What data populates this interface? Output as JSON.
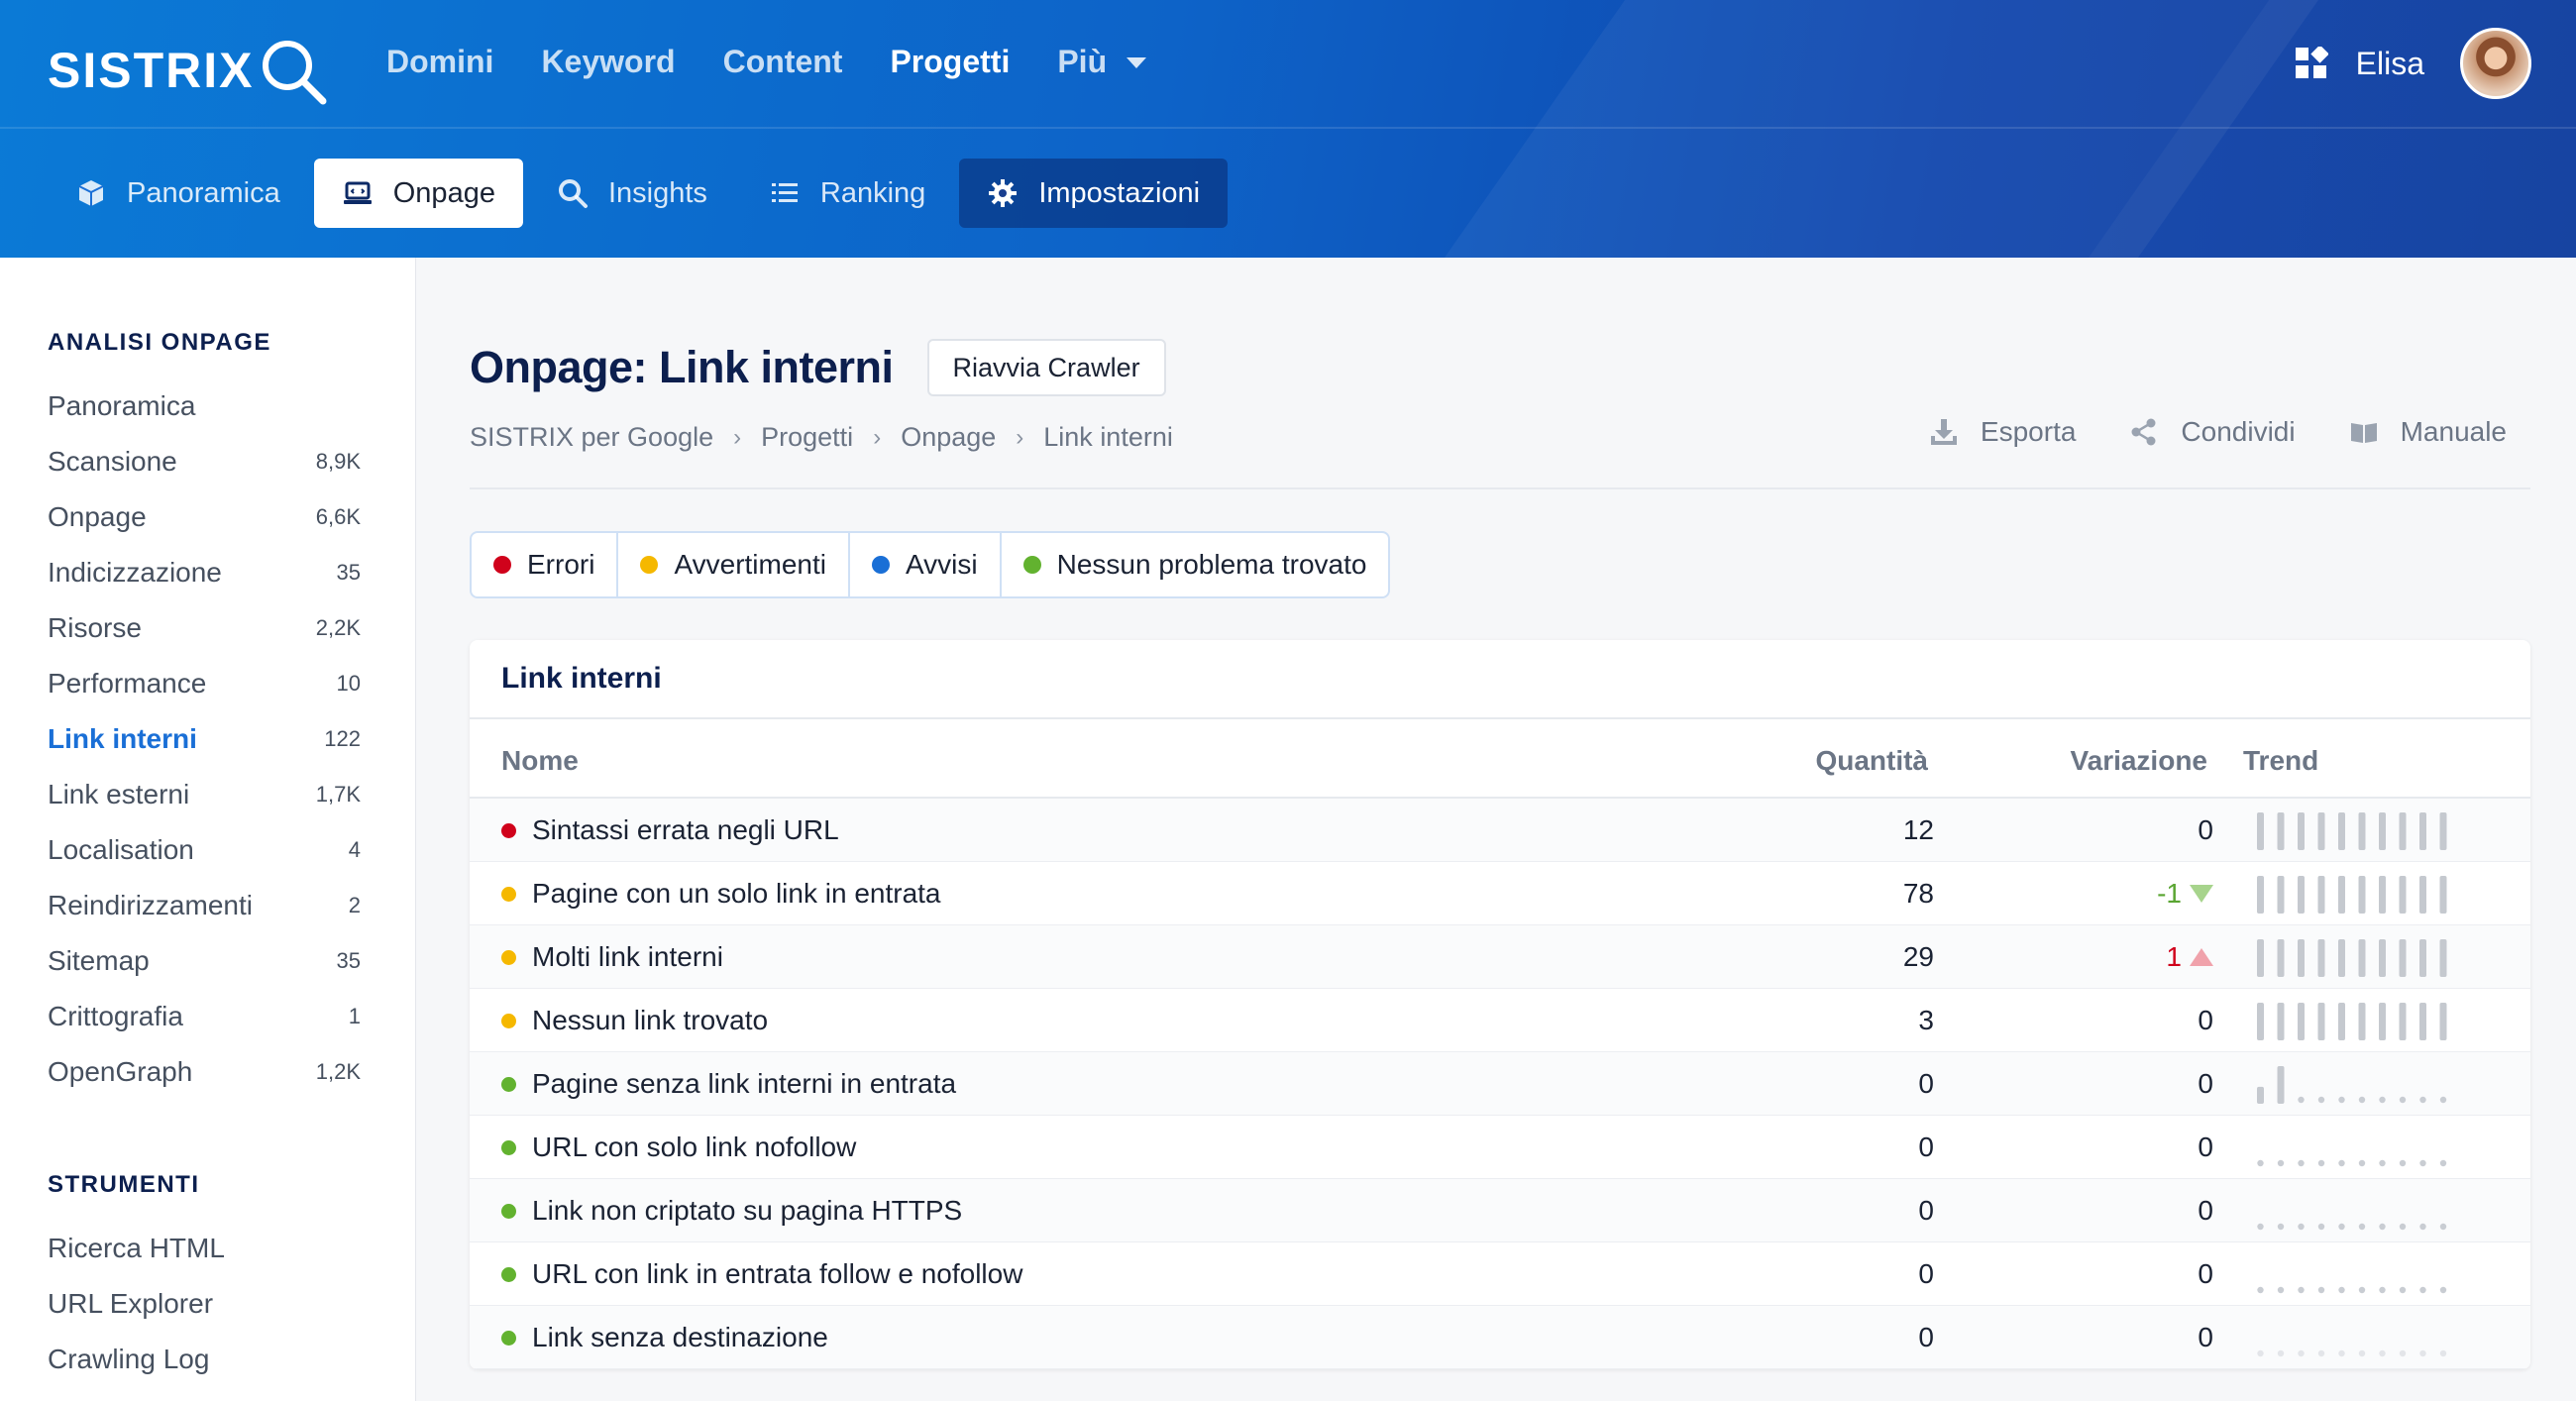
{
  "colors": {
    "error": "#d0021b",
    "warning": "#f5b800",
    "notice": "#1a6fd6",
    "ok": "#62b22f"
  },
  "header": {
    "logo": "SISTRIX",
    "logo_icon": "magnifier-icon",
    "nav": [
      "Domini",
      "Keyword",
      "Content",
      "Progetti",
      "Più"
    ],
    "active_nav": "Progetti",
    "user_name": "Elisa",
    "apps_icon": "apps-grid-icon"
  },
  "subnav": {
    "tabs": [
      {
        "label": "Panoramica",
        "icon": "box-icon"
      },
      {
        "label": "Onpage",
        "icon": "laptop-icon"
      },
      {
        "label": "Insights",
        "icon": "search-icon"
      },
      {
        "label": "Ranking",
        "icon": "list-icon"
      },
      {
        "label": "Impostazioni",
        "icon": "gear-icon"
      }
    ],
    "active": "Onpage"
  },
  "sidebar": {
    "section1_title": "ANALISI ONPAGE",
    "items": [
      {
        "label": "Panoramica",
        "count": ""
      },
      {
        "label": "Scansione",
        "count": "8,9K"
      },
      {
        "label": "Onpage",
        "count": "6,6K"
      },
      {
        "label": "Indicizzazione",
        "count": "35"
      },
      {
        "label": "Risorse",
        "count": "2,2K"
      },
      {
        "label": "Performance",
        "count": "10"
      },
      {
        "label": "Link interni",
        "count": "122"
      },
      {
        "label": "Link esterni",
        "count": "1,7K"
      },
      {
        "label": "Localisation",
        "count": "4"
      },
      {
        "label": "Reindirizzamenti",
        "count": "2"
      },
      {
        "label": "Sitemap",
        "count": "35"
      },
      {
        "label": "Crittografia",
        "count": "1"
      },
      {
        "label": "OpenGraph",
        "count": "1,2K"
      }
    ],
    "active": "Link interni",
    "section2_title": "STRUMENTI",
    "tools": [
      "Ricerca HTML",
      "URL Explorer",
      "Crawling Log"
    ]
  },
  "main": {
    "title": "Onpage: Link interni",
    "restart_button": "Riavvia Crawler",
    "breadcrumb": [
      "SISTRIX per Google",
      "Progetti",
      "Onpage",
      "Link interni"
    ],
    "actions": [
      {
        "label": "Esporta",
        "icon": "download-icon"
      },
      {
        "label": "Condividi",
        "icon": "share-icon"
      },
      {
        "label": "Manuale",
        "icon": "book-icon"
      }
    ],
    "filters": [
      {
        "label": "Errori",
        "status": "error"
      },
      {
        "label": "Avvertimenti",
        "status": "warning"
      },
      {
        "label": "Avvisi",
        "status": "notice"
      },
      {
        "label": "Nessun problema trovato",
        "status": "ok"
      }
    ]
  },
  "table": {
    "title": "Link interni",
    "headers": {
      "name": "Nome",
      "qty": "Quantità",
      "change": "Variazione",
      "trend": "Trend"
    },
    "rows": [
      {
        "name": "Sintassi errata negli URL",
        "status": "error",
        "qty": "12",
        "change": "0",
        "direction": "none",
        "trend": [
          1,
          1,
          1,
          1,
          1,
          1,
          1,
          1,
          1,
          1
        ]
      },
      {
        "name": "Pagine con un solo link in entrata",
        "status": "warning",
        "qty": "78",
        "change": "-1",
        "direction": "down",
        "trend": [
          1,
          1,
          1,
          1,
          1,
          1,
          1,
          1,
          1,
          1
        ]
      },
      {
        "name": "Molti link interni",
        "status": "warning",
        "qty": "29",
        "change": "1",
        "direction": "up",
        "trend": [
          1,
          1,
          1,
          1,
          1,
          1,
          1,
          1,
          1,
          1
        ]
      },
      {
        "name": "Nessun link trovato",
        "status": "warning",
        "qty": "3",
        "change": "0",
        "direction": "none",
        "trend": [
          1,
          1,
          1,
          1,
          1,
          1,
          1,
          1,
          1,
          1
        ]
      },
      {
        "name": "Pagine senza link interni in entrata",
        "status": "ok",
        "qty": "0",
        "change": "0",
        "direction": "none",
        "trend": [
          0.45,
          1,
          0,
          0,
          0,
          0,
          0,
          0,
          0,
          0
        ]
      },
      {
        "name": "URL con solo link nofollow",
        "status": "ok",
        "qty": "0",
        "change": "0",
        "direction": "none",
        "trend": [
          0,
          0,
          0,
          0,
          0,
          0,
          0,
          0,
          0,
          0
        ]
      },
      {
        "name": "Link non criptato su pagina HTTPS",
        "status": "ok",
        "qty": "0",
        "change": "0",
        "direction": "none",
        "trend": [
          0,
          0,
          0,
          0,
          0,
          0,
          0,
          0,
          0,
          0
        ]
      },
      {
        "name": "URL con link in entrata follow e nofollow",
        "status": "ok",
        "qty": "0",
        "change": "0",
        "direction": "none",
        "trend": [
          0,
          0,
          0,
          0,
          0,
          0,
          0,
          0,
          0,
          0
        ]
      },
      {
        "name": "Link senza destinazione",
        "status": "ok",
        "qty": "0",
        "change": "0",
        "direction": "none",
        "trend": [
          0,
          0,
          0,
          0,
          0,
          0,
          0,
          0,
          0,
          0
        ]
      }
    ]
  }
}
